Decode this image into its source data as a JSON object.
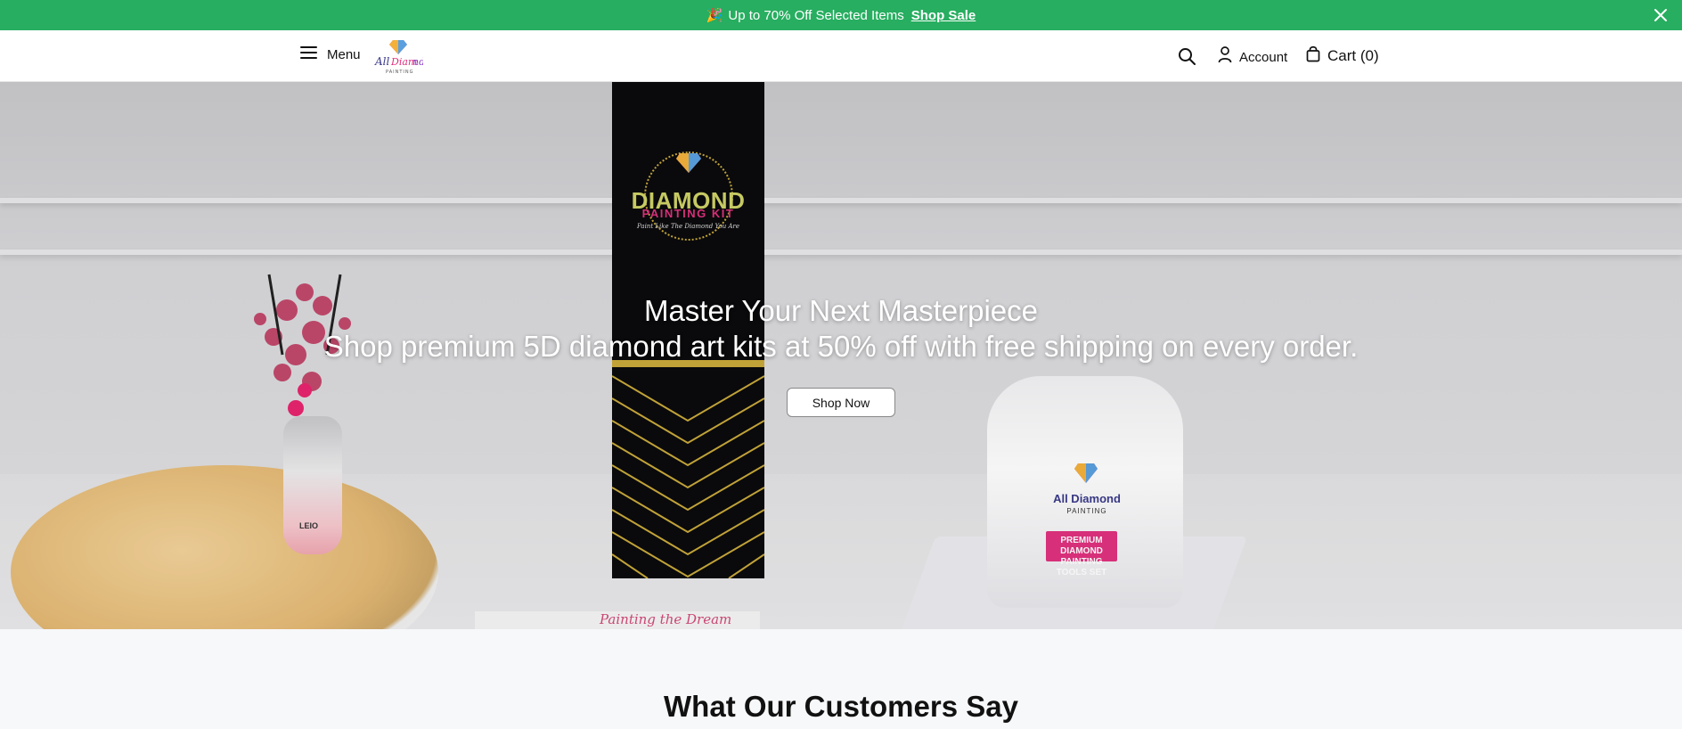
{
  "announcement": {
    "emoji": "🎉",
    "text": "Up to 70% Off Selected Items",
    "link_label": "Shop Sale"
  },
  "header": {
    "menu_label": "Menu",
    "logo_text": "All Diamond",
    "logo_subtext": "PAINTING",
    "account_label": "Account",
    "cart_label": "Cart (0)"
  },
  "hero": {
    "title": "Master Your Next Masterpiece",
    "subtitle": "Shop premium 5D diamond art kits at 50% off with free shipping on every order.",
    "cta_label": "Shop Now",
    "box_title": "DIAMOND",
    "box_subtitle": "PAINTING KIT",
    "box_tagline": "Paint Like The Diamond You Are",
    "bag_brand": "All Diamond",
    "bag_brand_sub": "PAINTING",
    "bag_tag": "PREMIUM DIAMOND PAINTING TOOLS SET",
    "vase_label": "LEIO",
    "paper_text": "Painting the Dream"
  },
  "sections": {
    "testimonials_title": "What Our Customers Say"
  },
  "colors": {
    "announcement_bg": "#27ae60",
    "accent_pink": "#e0317e"
  }
}
